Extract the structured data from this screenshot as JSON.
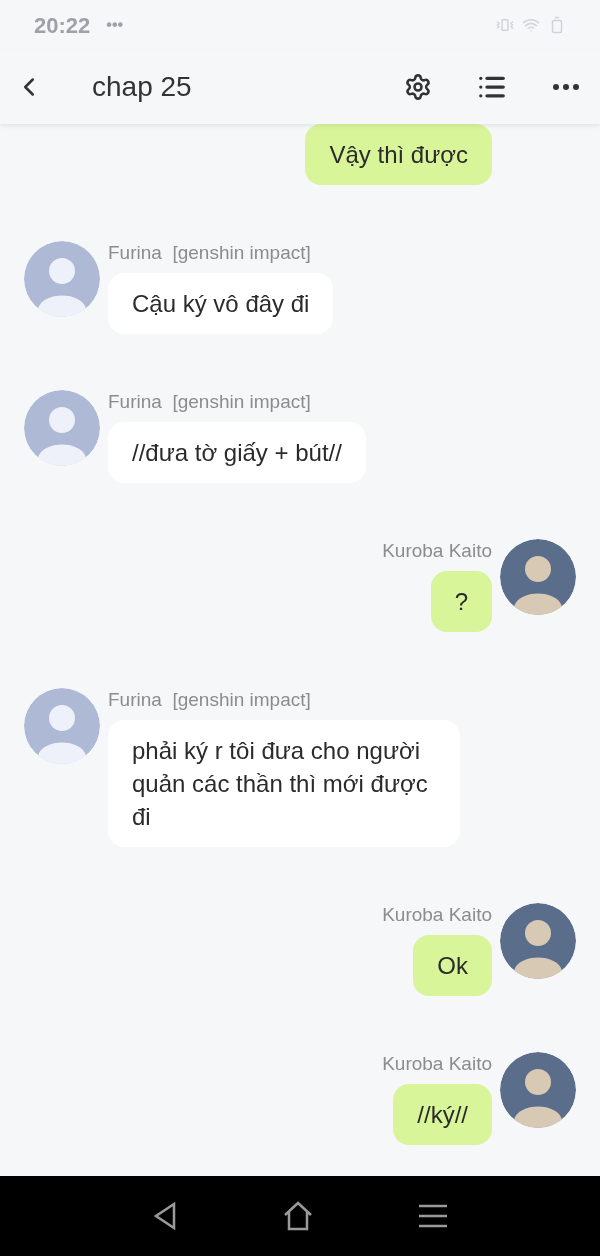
{
  "status_bar": {
    "time": "20:22",
    "dots": "•••"
  },
  "header": {
    "title": "chap 25"
  },
  "messages": [
    {
      "kind": "outgoing",
      "text": "Vậy thì được"
    },
    {
      "kind": "incoming",
      "sender": "Furina  [genshin impact]",
      "text": "Cậu ký vô đây đi"
    },
    {
      "kind": "incoming",
      "sender": "Furina  [genshin impact]",
      "text": "//đưa tờ giấy + bút//"
    },
    {
      "kind": "outgoing",
      "sender": "Kuroba Kaito",
      "text": "?"
    },
    {
      "kind": "incoming",
      "sender": "Furina  [genshin impact]",
      "text": "phải ký r tôi đưa cho người quản các thần thì mới được đi"
    },
    {
      "kind": "outgoing",
      "sender": "Kuroba Kaito",
      "text": "Ok"
    },
    {
      "kind": "outgoing",
      "sender": "Kuroba Kaito",
      "text": "//ký//"
    }
  ]
}
